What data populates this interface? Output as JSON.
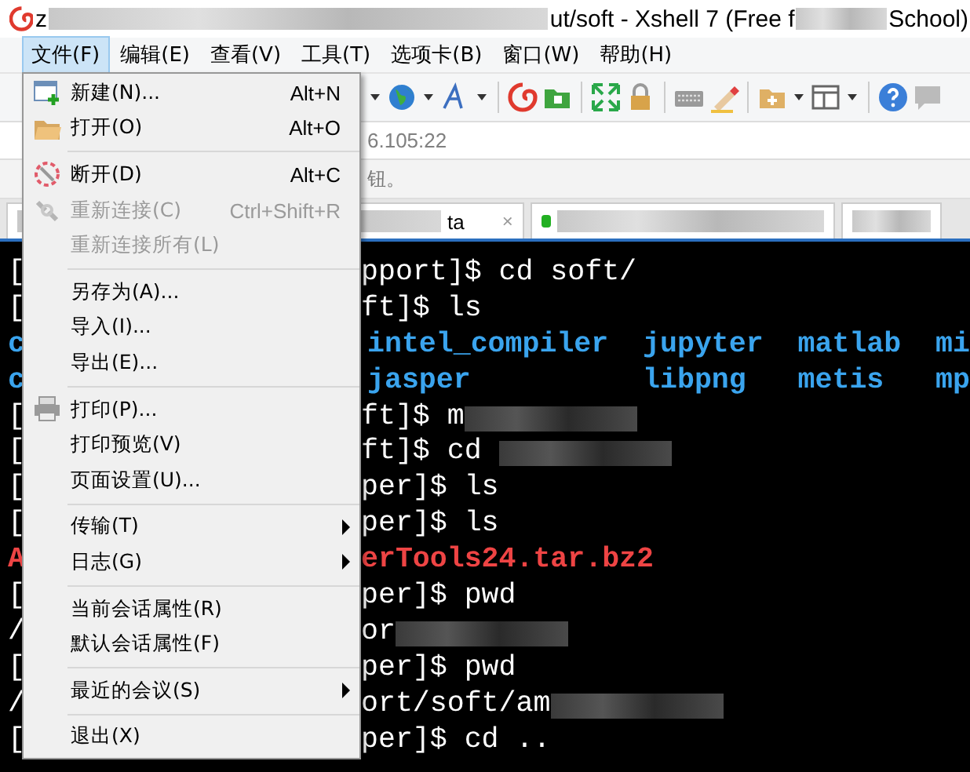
{
  "window": {
    "title_segments": [
      {
        "kind": "text",
        "text": "z"
      },
      {
        "kind": "blur"
      },
      {
        "kind": "text",
        "text": "ut/soft - Xshell 7 (Free f"
      },
      {
        "kind": "blur"
      },
      {
        "kind": "text",
        "text": "School)"
      }
    ]
  },
  "menubar": [
    {
      "label": "文件(F)",
      "selected": true
    },
    {
      "label": "编辑(E)",
      "selected": false
    },
    {
      "label": "查看(V)",
      "selected": false
    },
    {
      "label": "工具(T)",
      "selected": false
    },
    {
      "label": "选项卡(B)",
      "selected": false
    },
    {
      "label": "窗口(W)",
      "selected": false
    },
    {
      "label": "帮助(H)",
      "selected": false
    }
  ],
  "address_bar": {
    "value": "6.105:22"
  },
  "notice_bar": {
    "text": "钮。"
  },
  "tabs": [
    {
      "label": "ta",
      "close": "×",
      "connected": false
    },
    {
      "connected": true
    },
    {
      "connected": false
    }
  ],
  "terminal": {
    "lines": [
      {
        "left": "[",
        "text": "pport]$ cd soft/",
        "color": "#ffffff",
        "bold": false,
        "blurred": false
      },
      {
        "left": "[",
        "text": "ft]$ ls",
        "color": "#ffffff",
        "bold": false,
        "blurred": false
      },
      {
        "left": "c",
        "text": " intel_compiler  jupyter  matlab  mi",
        "color": "#3aa4ee",
        "bold": true,
        "blurred": false
      },
      {
        "left": "c",
        "text": " jasper          libpng   metis   mp",
        "color": "#3aa4ee",
        "bold": true,
        "blurred": false
      },
      {
        "left": "[",
        "text": "ft]$ m",
        "color": "#ffffff",
        "bold": false,
        "blurred": true
      },
      {
        "left": "[",
        "text": "ft]$ cd ",
        "color": "#ffffff",
        "bold": false,
        "blurred": true
      },
      {
        "left": "[",
        "text": "per]$ ls",
        "color": "#ffffff",
        "bold": false,
        "blurred": false
      },
      {
        "left": "[",
        "text": "per]$ ls",
        "color": "#ffffff",
        "bold": false,
        "blurred": false
      },
      {
        "left": "A",
        "text": "erTools24.tar.bz2",
        "color": "#ee4444",
        "bold": true,
        "blurred": false
      },
      {
        "left": "[",
        "text": "per]$ pwd",
        "color": "#ffffff",
        "bold": false,
        "blurred": false
      },
      {
        "left": "/",
        "text": "or",
        "color": "#ffffff",
        "bold": false,
        "blurred": true
      },
      {
        "left": "[",
        "text": "per]$ pwd",
        "color": "#ffffff",
        "bold": false,
        "blurred": false
      },
      {
        "left": "/",
        "text": "ort/soft/am",
        "color": "#ffffff",
        "bold": false,
        "blurred": true
      },
      {
        "left": "[",
        "text": "per]$ cd ..",
        "color": "#ffffff",
        "bold": false,
        "blurred": false
      }
    ]
  },
  "file_menu": {
    "items": [
      {
        "kind": "item",
        "label": "新建(N)...",
        "shortcut": "Alt+N",
        "disabled": false,
        "submenu": false
      },
      {
        "kind": "item",
        "label": "打开(O)",
        "shortcut": "Alt+O",
        "disabled": false,
        "submenu": false
      },
      {
        "kind": "separator"
      },
      {
        "kind": "item",
        "label": "断开(D)",
        "shortcut": "Alt+C",
        "disabled": false,
        "submenu": false
      },
      {
        "kind": "item",
        "label": "重新连接(C)",
        "shortcut": "Ctrl+Shift+R",
        "disabled": true,
        "submenu": false
      },
      {
        "kind": "item",
        "label": "重新连接所有(L)",
        "disabled": true,
        "submenu": false
      },
      {
        "kind": "separator"
      },
      {
        "kind": "item",
        "label": "另存为(A)...",
        "disabled": false,
        "submenu": false
      },
      {
        "kind": "item",
        "label": "导入(I)...",
        "disabled": false,
        "submenu": false
      },
      {
        "kind": "item",
        "label": "导出(E)...",
        "disabled": false,
        "submenu": false
      },
      {
        "kind": "separator"
      },
      {
        "kind": "item",
        "label": "打印(P)...",
        "disabled": false,
        "submenu": false
      },
      {
        "kind": "item",
        "label": "打印预览(V)",
        "disabled": false,
        "submenu": false
      },
      {
        "kind": "item",
        "label": "页面设置(U)...",
        "disabled": false,
        "submenu": false
      },
      {
        "kind": "separator"
      },
      {
        "kind": "item",
        "label": "传输(T)",
        "disabled": false,
        "submenu": true
      },
      {
        "kind": "item",
        "label": "日志(G)",
        "disabled": false,
        "submenu": true
      },
      {
        "kind": "separator"
      },
      {
        "kind": "item",
        "label": "当前会话属性(R)",
        "disabled": false,
        "submenu": false
      },
      {
        "kind": "item",
        "label": "默认会话属性(F)",
        "disabled": false,
        "submenu": false
      },
      {
        "kind": "separator"
      },
      {
        "kind": "item",
        "label": "最近的会议(S)",
        "disabled": false,
        "submenu": true
      },
      {
        "kind": "separator"
      },
      {
        "kind": "item",
        "label": "退出(X)",
        "disabled": false,
        "submenu": false
      }
    ]
  }
}
